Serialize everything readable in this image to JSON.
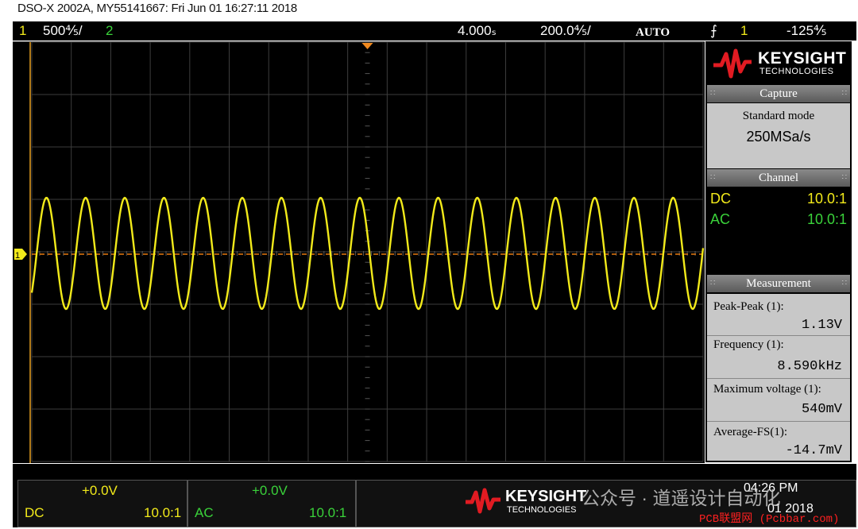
{
  "title": "DSO-X 2002A, MY55141667: Fri Jun 01 16:27:11 2018",
  "topbar": {
    "ch1_num": "1",
    "ch1_scale": "500⅘/",
    "ch2_num": "2",
    "delay": "4.000ₛ",
    "timebase": "200.0⅘/",
    "trigger_mode": "AUTO",
    "trigger_slope_icon": "rising-edge-icon",
    "trigger_source": "1",
    "trigger_level": "-125⅘"
  },
  "brand": {
    "name": "KEYSIGHT",
    "sub": "TECHNOLOGIES",
    "color": "#e11b22"
  },
  "panel": {
    "capture": {
      "title": "Capture",
      "mode": "Standard mode",
      "rate": "250MSa/s"
    },
    "channel": {
      "title": "Channel",
      "rows": [
        {
          "coupling": "DC",
          "probe": "10.0:1",
          "color": "#f2ea1a"
        },
        {
          "coupling": "AC",
          "probe": "10.0:1",
          "color": "#3ad23a"
        }
      ]
    },
    "measurement": {
      "title": "Measurement",
      "items": [
        {
          "label": "Peak-Peak (1):",
          "value": "1.13V"
        },
        {
          "label": "Frequency (1):",
          "value": "8.590kHz"
        },
        {
          "label": "Maximum voltage (1):",
          "value": "540mV"
        },
        {
          "label": "Average-FS(1):",
          "value": "-14.7mV"
        }
      ]
    }
  },
  "bottom": {
    "ch1": {
      "offset": "+0.0V",
      "coupling": "DC",
      "probe": "10.0:1"
    },
    "ch2": {
      "offset": "+0.0V",
      "coupling": "AC",
      "probe": "10.0:1"
    },
    "time": "04:26 PM",
    "date": "01 2018"
  },
  "watermark": {
    "cn": "公众号 · 道遥设计自动化",
    "pcb": "PCB联盟网 (Pcbbar.com)"
  },
  "trace": {
    "color": "#f2ea1a",
    "cycles": 17,
    "ground_marker": "1"
  }
}
